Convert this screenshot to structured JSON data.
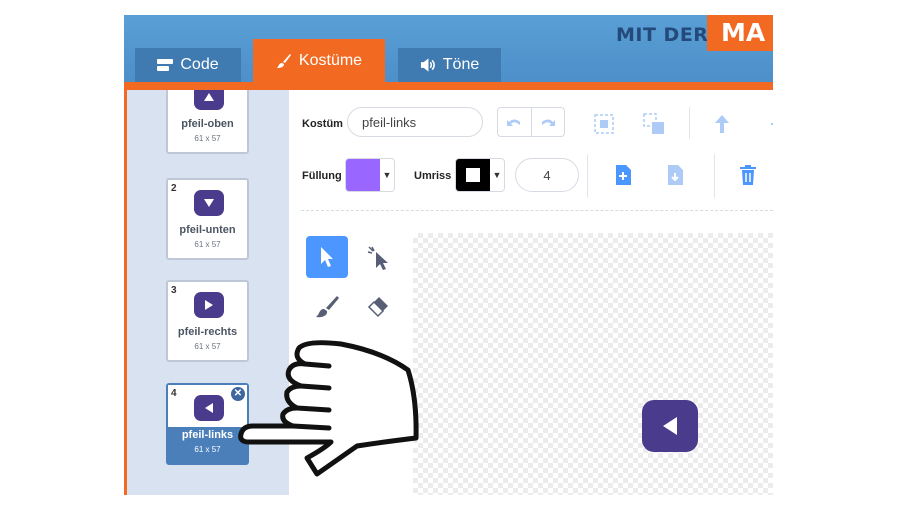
{
  "brand": {
    "text": "MIT DER",
    "box_text": "MA"
  },
  "tabs": [
    {
      "label": "Code",
      "icon": "code-blocks-icon"
    },
    {
      "label": "Kostüme",
      "icon": "brush-icon",
      "active": true
    },
    {
      "label": "Töne",
      "icon": "speaker-icon"
    }
  ],
  "costumes": [
    {
      "number": "",
      "name": "pfeil-oben",
      "size": "61 x 57",
      "arrow": "up"
    },
    {
      "number": "2",
      "name": "pfeil-unten",
      "size": "61 x 57",
      "arrow": "down"
    },
    {
      "number": "3",
      "name": "pfeil-rechts",
      "size": "61 x 57",
      "arrow": "right"
    },
    {
      "number": "4",
      "name": "pfeil-links",
      "size": "61 x 57",
      "arrow": "left",
      "selected": true
    }
  ],
  "editor": {
    "costume_label": "Kostüm",
    "costume_name": "pfeil-links",
    "fill_label": "Füllung",
    "fill_color": "#9966ff",
    "outline_label": "Umriss",
    "outline_color": "#000000",
    "outline_width": "4"
  },
  "colors": {
    "accent": "#f26a21",
    "tab_blue": "#3f7ab0",
    "sprite": "#4b3b8c",
    "tool_active": "#4c97ff"
  }
}
